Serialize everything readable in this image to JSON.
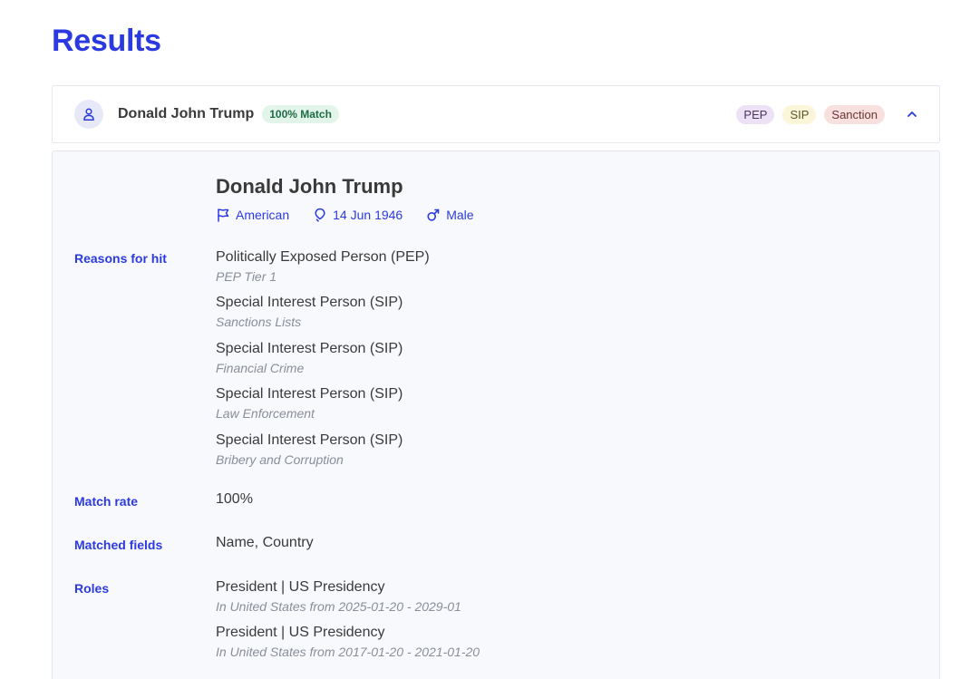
{
  "page": {
    "title": "Results"
  },
  "result": {
    "name": "Donald John Trump",
    "match_badge": "100% Match",
    "tags": [
      "PEP",
      "SIP",
      "Sanction"
    ],
    "expanded": true
  },
  "detail": {
    "name": "Donald John Trump",
    "nationality": "American",
    "birth_date": "14 Jun 1946",
    "gender": "Male",
    "labels": {
      "reasons": "Reasons for hit",
      "match_rate": "Match rate",
      "matched_fields": "Matched fields",
      "roles": "Roles"
    },
    "reasons": [
      {
        "title": "Politically Exposed Person (PEP)",
        "sub": "PEP Tier 1"
      },
      {
        "title": "Special Interest Person (SIP)",
        "sub": "Sanctions Lists"
      },
      {
        "title": "Special Interest Person (SIP)",
        "sub": "Financial Crime"
      },
      {
        "title": "Special Interest Person (SIP)",
        "sub": "Law Enforcement"
      },
      {
        "title": "Special Interest Person (SIP)",
        "sub": "Bribery and Corruption"
      }
    ],
    "match_rate": "100%",
    "matched_fields": "Name, Country",
    "roles": [
      {
        "title": "President | US Presidency",
        "sub": "In United States from 2025-01-20 - 2029-01"
      },
      {
        "title": "President | US Presidency",
        "sub": "In United States from 2017-01-20 - 2021-01-20"
      }
    ]
  },
  "colors": {
    "accent": "#2b3ae0",
    "match_badge_bg": "#e3f5ea",
    "pep_tag_bg": "#ece1f5",
    "sip_tag_bg": "#fbf5d9",
    "sanction_tag_bg": "#f8e0df",
    "panel_bg": "#f8f9fc"
  },
  "icons": {
    "avatar": "user-icon",
    "collapse": "chevron-up-icon",
    "nationality": "flag-icon",
    "birth": "location-pin-icon",
    "gender": "male-icon"
  }
}
